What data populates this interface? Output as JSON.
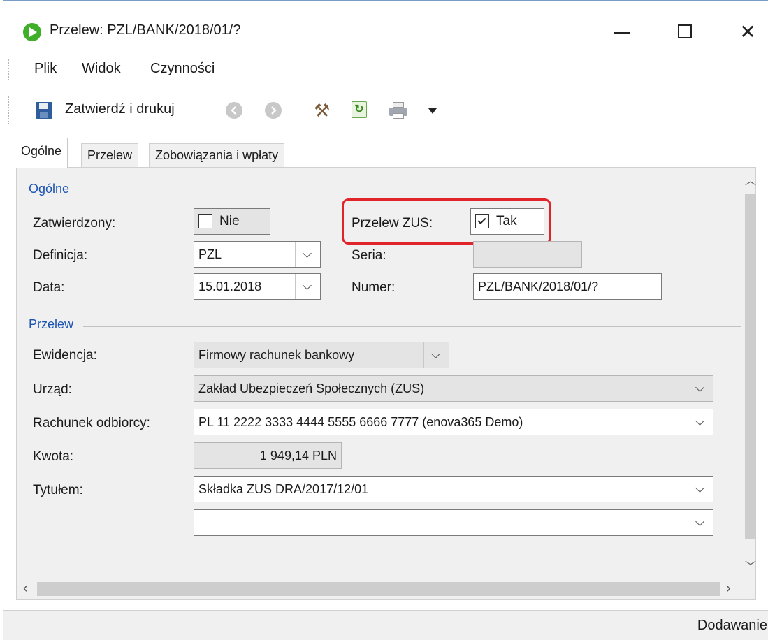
{
  "window": {
    "title": "Przelew: PZL/BANK/2018/01/?",
    "minimize_symbol": "",
    "maximize_symbol": "",
    "close_symbol": "✕"
  },
  "menu": [
    "Plik",
    "Widok",
    "Czynności"
  ],
  "toolbar": {
    "save_label": "Zatwierdź i drukuj"
  },
  "tabs": [
    "Ogólne",
    "Przelew",
    "Zobowiązania i wpłaty"
  ],
  "section_general": {
    "title": "Ogólne",
    "approved_label": "Zatwierdzony:",
    "approved_value": "Nie",
    "definition_label": "Definicja:",
    "definition_value": "PZL",
    "date_label": "Data:",
    "date_value": "15.01.2018",
    "zus_label": "Przelew ZUS:",
    "zus_value": "Tak",
    "series_label": "Seria:",
    "series_value": "",
    "number_label": "Numer:",
    "number_value": "PZL/BANK/2018/01/?"
  },
  "section_transfer": {
    "title": "Przelew",
    "record_label": "Ewidencja:",
    "record_value": "Firmowy rachunek bankowy",
    "office_label": "Urząd:",
    "office_value": "Zakład Ubezpieczeń Społecznych (ZUS)",
    "account_label": "Rachunek odbiorcy:",
    "account_value": "PL 11 2222 3333 4444 5555 6666 7777 (enova365 Demo)",
    "amount_label": "Kwota:",
    "amount_value": "1 949,14 PLN",
    "title_label": "Tytułem:",
    "title_value": "Składka ZUS DRA/2017/12/01",
    "title_value2": ""
  },
  "status": "Dodawanie",
  "colors": {
    "highlight": "#e0242a",
    "section_title": "#1a54b0",
    "app_icon": "#3fae29"
  }
}
